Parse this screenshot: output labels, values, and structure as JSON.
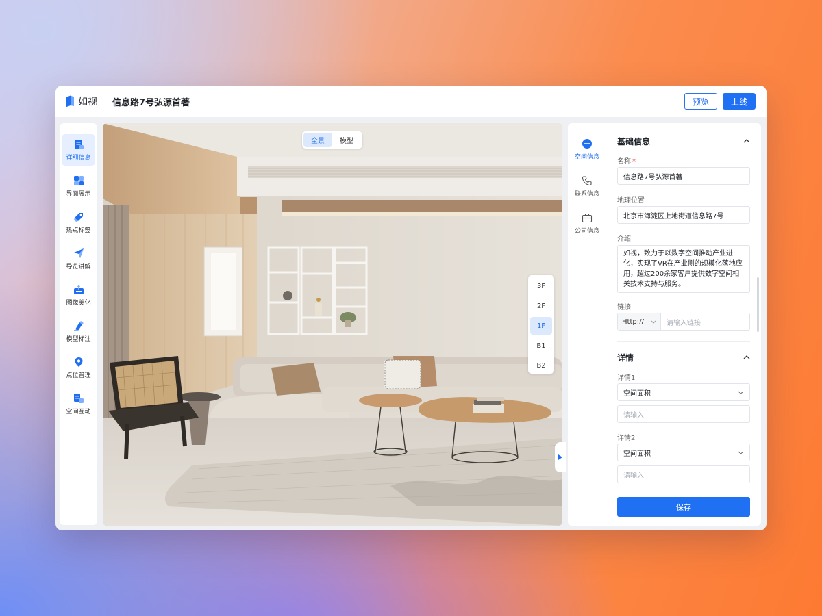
{
  "app": {
    "logo_text": "如视",
    "project_title": "信息路7号弘源首著"
  },
  "topbar": {
    "preview_label": "预览",
    "publish_label": "上线"
  },
  "sidebar": {
    "items": [
      {
        "label": "详细信息",
        "icon": "detail-info-icon",
        "active": true
      },
      {
        "label": "界面展示",
        "icon": "interface-display-icon",
        "active": false
      },
      {
        "label": "热点标签",
        "icon": "hotspot-tag-icon",
        "active": false
      },
      {
        "label": "导览讲解",
        "icon": "guided-tour-icon",
        "active": false
      },
      {
        "label": "图像美化",
        "icon": "image-beautify-icon",
        "active": false
      },
      {
        "label": "模型标注",
        "icon": "model-annotation-icon",
        "active": false
      },
      {
        "label": "点位管理",
        "icon": "location-pin-icon",
        "active": false
      },
      {
        "label": "空间互动",
        "icon": "space-interaction-icon",
        "active": false
      }
    ]
  },
  "viewer": {
    "view_toggle": [
      {
        "label": "全景",
        "active": true
      },
      {
        "label": "模型",
        "active": false
      }
    ],
    "floors": [
      {
        "label": "3F",
        "active": false
      },
      {
        "label": "2F",
        "active": false
      },
      {
        "label": "1F",
        "active": true
      },
      {
        "label": "B1",
        "active": false
      },
      {
        "label": "B2",
        "active": false
      }
    ]
  },
  "right_tabs": [
    {
      "label": "空间信息",
      "icon": "chat-bubble-icon",
      "active": true
    },
    {
      "label": "联系信息",
      "icon": "phone-icon",
      "active": false
    },
    {
      "label": "公司信息",
      "icon": "briefcase-icon",
      "active": false
    }
  ],
  "basic_info": {
    "title": "基础信息",
    "name_label": "名称",
    "name_required_mark": "*",
    "name_value": "信息路7号弘源首著",
    "location_label": "地理位置",
    "location_value": "北京市海淀区上地街道信息路7号",
    "intro_label": "介绍",
    "intro_value": "如视，致力于以数字空间推动产业进化，实现了VR在产业侧的规模化落地应用，超过200余家客户提供数字空间相关技术支持与服务。",
    "link_label": "链接",
    "link_prefix": "Http://",
    "link_placeholder": "请输入链接"
  },
  "details": {
    "title": "详情",
    "items": [
      {
        "label": "详情1",
        "select_value": "空间面积",
        "input_placeholder": "请输入"
      },
      {
        "label": "详情2",
        "select_value": "空间面积",
        "input_placeholder": "请输入"
      }
    ],
    "save_label": "保存"
  },
  "colors": {
    "accent": "#1f70f2",
    "active_bg": "#e6efff"
  }
}
